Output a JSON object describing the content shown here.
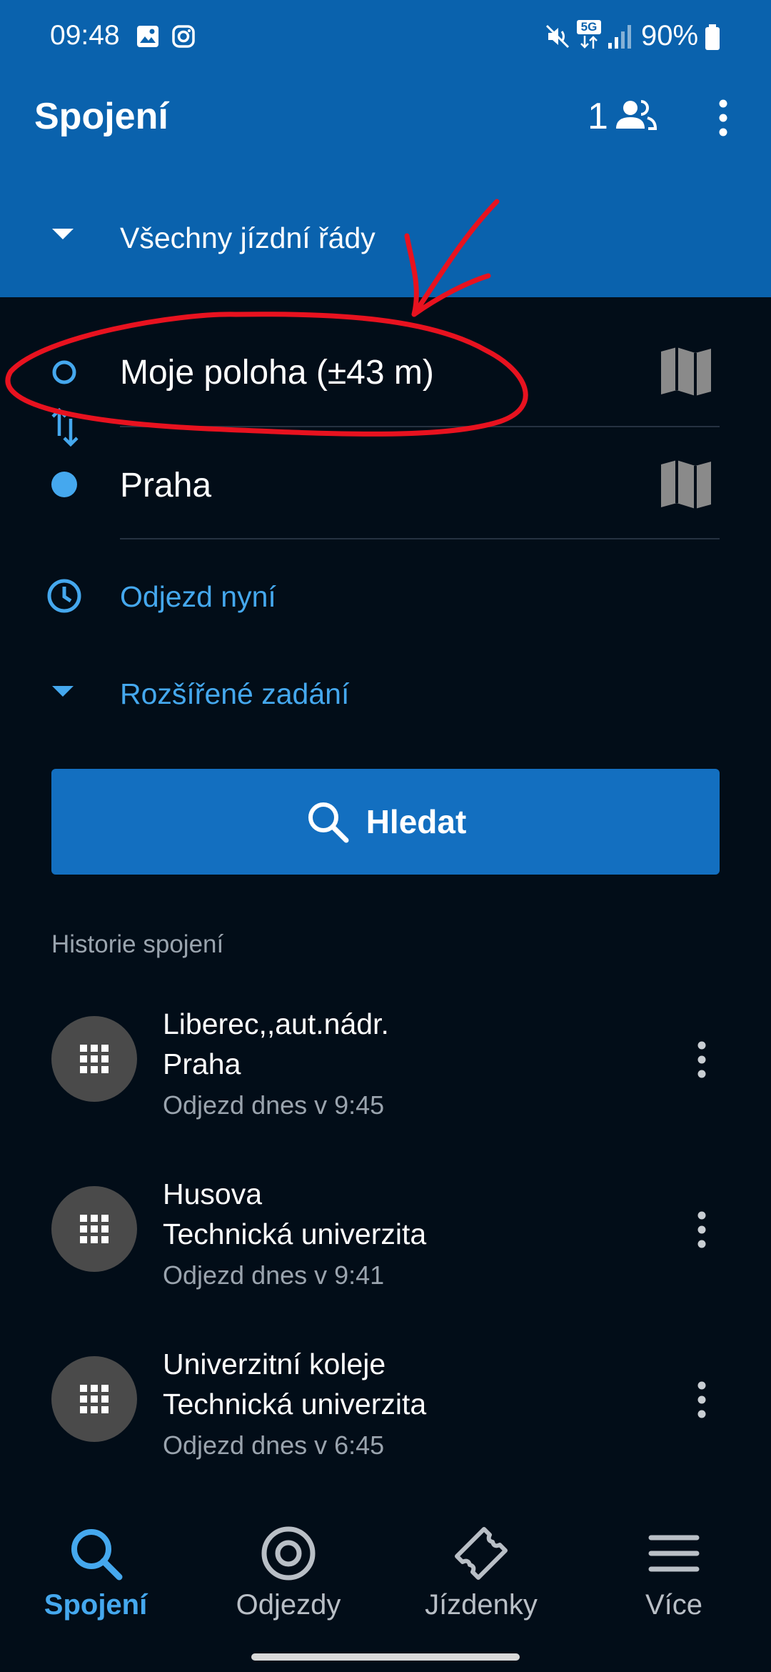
{
  "status_bar": {
    "time": "09:48",
    "battery": "90%",
    "network": "5G",
    "icons": [
      "gallery-icon",
      "instagram-icon",
      "mute-icon",
      "network-5g-icon",
      "signal-icon",
      "battery-icon"
    ]
  },
  "app_bar": {
    "title": "Spojení",
    "users_count": "1"
  },
  "timetable_selector": {
    "label": "Všechny jízdní řády"
  },
  "form": {
    "from_value": "Moje poloha (±43 m)",
    "to_value": "Praha",
    "time_label": "Odjezd nyní",
    "advanced_label": "Rozšířené zadání"
  },
  "search_button": {
    "label": "Hledat"
  },
  "history": {
    "title": "Historie spojení",
    "items": [
      {
        "from": "Liberec,,aut.nádr.",
        "to": "Praha",
        "time": "Odjezd dnes v 9:45"
      },
      {
        "from": "Husova",
        "to": "Technická univerzita",
        "time": "Odjezd dnes v 9:41"
      },
      {
        "from": "Univerzitní koleje",
        "to": "Technická univerzita",
        "time": "Odjezd dnes v 6:45"
      }
    ]
  },
  "bottom_nav": {
    "items": [
      {
        "label": "Spojení",
        "icon": "search-icon",
        "active": true
      },
      {
        "label": "Odjezdy",
        "icon": "target-icon",
        "active": false
      },
      {
        "label": "Jízdenky",
        "icon": "ticket-icon",
        "active": false
      },
      {
        "label": "Více",
        "icon": "menu-icon",
        "active": false
      }
    ]
  },
  "colors": {
    "header_blue": "#0a62ad",
    "background": "#020d18",
    "accent": "#45a8ee",
    "button": "#136fc0",
    "annotation_red": "#e8121f"
  }
}
